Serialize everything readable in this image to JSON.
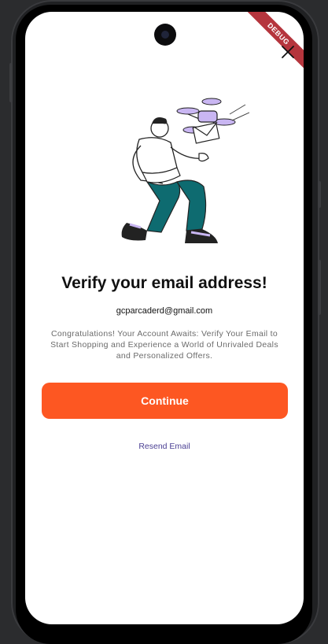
{
  "status": {
    "debug_banner": "DEBUG"
  },
  "verify": {
    "title": "Verify your email address!",
    "email": "gcparcaderd@gmail.com",
    "message": "Congratulations! Your Account Awaits: Verify Your Email to Start Shopping and Experience a World of Unrivaled Deals and Personalized Offers.",
    "continue_label": "Continue",
    "resend_label": "Resend Email"
  },
  "colors": {
    "primary": "#fd5722",
    "link": "#4a3f93",
    "illustration_teal": "#0e6b70",
    "illustration_lavender": "#c9b6f2"
  },
  "icons": {
    "close": "close-icon",
    "illustration": "email-delivery-drone-illustration"
  }
}
